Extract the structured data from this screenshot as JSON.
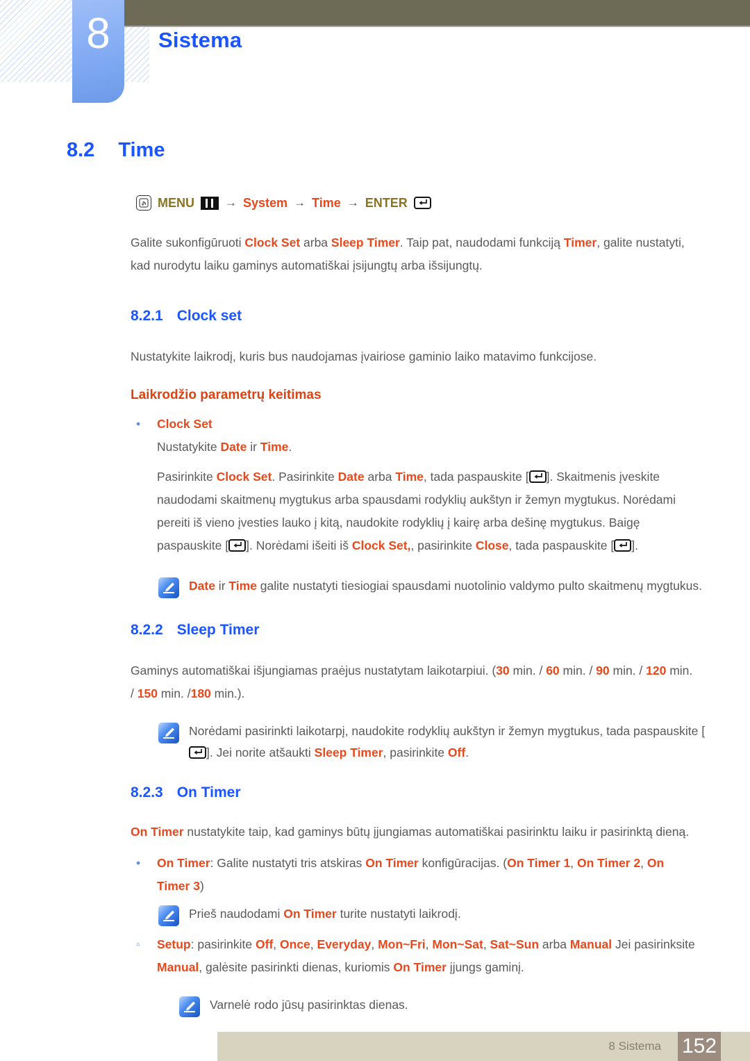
{
  "header": {
    "chapter_number": "8",
    "chapter_title": "Sistema",
    "hand_icon": "hand-press-icon",
    "accent_blue": "#1a55ff",
    "tab_gradient_from": "#9ebdf7",
    "topbar_color": "#6d6b56"
  },
  "section": {
    "number": "8.2",
    "title": "Time"
  },
  "menu_path": {
    "menu_label": "MENU",
    "arrow": "→",
    "item_system": "System",
    "item_time": "Time",
    "enter_label": "ENTER",
    "menu_icon": "menu-grid-icon",
    "enter_icon": "enter-key-icon"
  },
  "intro": {
    "p1_a": "Galite sukonfigūruoti ",
    "p1_b": "Clock Set",
    "p1_c": " arba ",
    "p1_d": "Sleep Timer",
    "p1_e": ". Taip pat, naudodami funkciją ",
    "p1_f": "Timer",
    "p1_g": ", galite nustatyti, kad nurodytu laiku gaminys automatiškai įsijungtų arba išsijungtų."
  },
  "clock_set": {
    "number": "8.2.1",
    "title": "Clock set",
    "desc": "Nustatykite laikrodį, kuris bus naudojamas įvairiose gaminio laiko matavimo funkcijose.",
    "subhead": "Laikrodžio parametrų keitimas",
    "bullet_dot": "•",
    "bullet_label": "Clock Set",
    "line_set_a": "Nustatykite ",
    "line_set_b": "Date",
    "line_set_c": " ir ",
    "line_set_d": "Time",
    "line_set_e": ".",
    "steps_1": "Pasirinkite ",
    "steps_2": "Clock Set",
    "steps_3": ". Pasirinkite ",
    "steps_4": "Date",
    "steps_5": " arba ",
    "steps_6": "Time",
    "steps_7": ", tada paspauskite [",
    "steps_8": "]. Skaitmenis įveskite naudodami skaitmenų mygtukus arba spausdami rodyklių aukštyn ir žemyn mygtukus. Norėdami pereiti iš vieno įvesties lauko į kitą, naudokite rodyklių į kairę arba dešinę mygtukus. Baigę paspauskite [",
    "steps_9": "]. Norėdami išeiti iš ",
    "steps_10": "Clock Set,",
    "steps_11": ", pasirinkite ",
    "steps_12": "Close",
    "steps_13": ", tada paspauskite [",
    "steps_14": "].",
    "note_a": "Date",
    "note_b": " ir ",
    "note_c": "Time",
    "note_d": " galite nustatyti tiesiogiai spausdami nuotolinio valdymo pulto skaitmenų mygtukus."
  },
  "sleep_timer": {
    "number": "8.2.2",
    "title": "Sleep Timer",
    "desc_a": "Gaminys automatiškai išjungiamas praėjus nustatytam laikotarpiui. (",
    "v1": "30",
    "u1": " min. / ",
    "v2": "60",
    "u2": " min. / ",
    "v3": "90",
    "u3": " min. / ",
    "v4": "120",
    "u4": " min. / ",
    "v5": "150",
    "u5": " min. /",
    "v6": "180",
    "u6": " min.).",
    "note_a": "Norėdami pasirinkti laikotarpį, naudokite rodyklių aukštyn ir žemyn mygtukus, tada paspauskite [",
    "note_b": "]. Jei norite atšaukti ",
    "note_c": "Sleep Timer",
    "note_d": ", pasirinkite ",
    "note_e": "Off",
    "note_f": "."
  },
  "on_timer": {
    "number": "8.2.3",
    "title": "On Timer",
    "desc_a": "On Timer",
    "desc_b": " nustatykite taip, kad gaminys būtų įjungiamas automatiškai pasirinktu laiku ir pasirinktą dieną.",
    "bullet_dot": "•",
    "b1_a": "On Timer",
    "b1_b": ": Galite nustatyti tris atskiras ",
    "b1_c": "On Timer",
    "b1_d": " konfigūracijas. (",
    "b1_e": "On Timer 1",
    "b1_f": ", ",
    "b1_g": "On Timer 2",
    "b1_h": ", ",
    "b1_i": "On Timer 3",
    "b1_j": ")",
    "note1_a": "Prieš naudodami ",
    "note1_b": "On Timer",
    "note1_c": " turite nustatyti laikrodį.",
    "setup_bullet": "▫",
    "setup_label": "Setup",
    "setup_a": ": pasirinkite ",
    "opt1": "Off",
    "opt2": "Once",
    "opt3": "Everyday",
    "opt4": "Mon~Fri",
    "opt5": "Mon~Sat",
    "opt6": "Sat~Sun",
    "setup_b": " arba ",
    "opt7": "Manual",
    "setup_c": " Jei pasirinksite ",
    "opt8": "Manual",
    "setup_d": ", galėsite pasirinkti dienas, kuriomis ",
    "opt9": "On Timer",
    "setup_e": " įjungs gaminį.",
    "note2": "Varnelė rodo jūsų pasirinktas dienas."
  },
  "footer": {
    "label": "8 Sistema",
    "page_number": "152",
    "bar_color": "#d8d3bf",
    "page_box_color": "#9c8c80"
  }
}
